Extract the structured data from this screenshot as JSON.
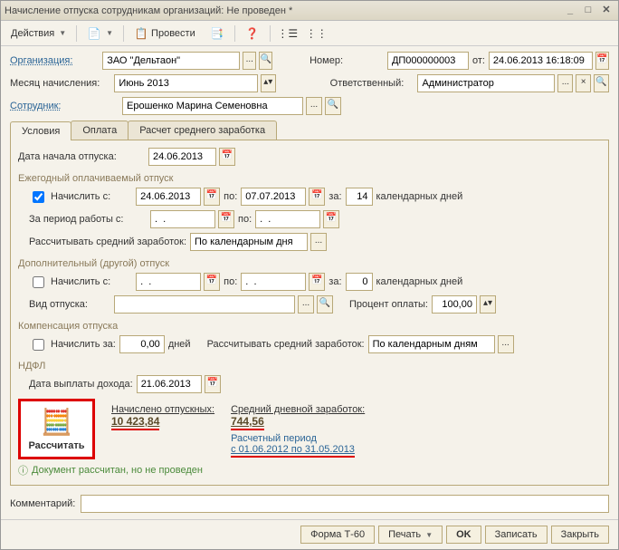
{
  "window": {
    "title": "Начисление отпуска сотрудникам организаций: Не проведен *"
  },
  "toolbar": {
    "actions": "Действия",
    "provesti": "Провести"
  },
  "header": {
    "org_label": "Организация:",
    "org_value": "ЗАО \"Дельтаон\"",
    "number_label": "Номер:",
    "number_value": "ДП000000003",
    "ot_label": "от:",
    "date_value": "24.06.2013 16:18:09",
    "month_label": "Месяц начисления:",
    "month_value": "Июнь 2013",
    "resp_label": "Ответственный:",
    "resp_value": "Администратор",
    "emp_label": "Сотрудник:",
    "emp_value": "Ерошенко Марина Семеновна"
  },
  "tabs": {
    "t1": "Условия",
    "t2": "Оплата",
    "t3": "Расчет среднего заработка"
  },
  "conditions": {
    "start_label": "Дата начала отпуска:",
    "start_value": "24.06.2013",
    "annual_title": "Ежегодный оплачиваемый отпуск",
    "accrue_from": "Начислить с:",
    "from_value": "24.06.2013",
    "to_label": "по:",
    "to_value": "07.07.2013",
    "for_label": "за:",
    "days_value": "14",
    "days_text": "календарных дней",
    "period_label": "За период работы с:",
    "period_from": ".  .",
    "period_to": ".  .",
    "avg_label": "Рассчитывать средний заработок:",
    "avg_value": "По календарным дня",
    "additional_title": "Дополнительный (другой) отпуск",
    "add_from": ".  .",
    "add_to": ".  .",
    "add_days": "0",
    "vac_type_label": "Вид отпуска:",
    "percent_label": "Процент оплаты:",
    "percent_value": "100,00",
    "comp_title": "Компенсация отпуска",
    "comp_accrue": "Начислить за:",
    "comp_value": "0,00",
    "comp_days": "дней",
    "comp_avg_label": "Рассчитывать средний заработок:",
    "comp_avg_value": "По календарным дням",
    "ndfl_title": "НДФЛ",
    "income_date_label": "Дата выплаты дохода:",
    "income_date_value": "21.06.2013",
    "calc_button": "Рассчитать",
    "accrued_label": "Начислено отпускных:",
    "accrued_value": "10 423,84",
    "daily_label": "Средний дневной заработок:",
    "daily_value": "744,56",
    "period_text1": "Расчетный период",
    "period_text2": "с 01.06.2012 по 31.05.2013",
    "status_text": "Документ рассчитан, но не проведен"
  },
  "comment_label": "Комментарий:",
  "footer": {
    "form": "Форма Т-60",
    "print": "Печать",
    "ok": "OK",
    "save": "Записать",
    "close": "Закрыть"
  }
}
